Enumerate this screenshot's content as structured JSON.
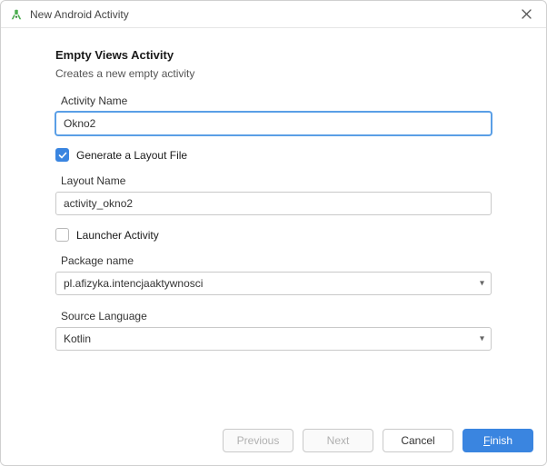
{
  "window": {
    "title": "New Android Activity"
  },
  "header": {
    "title": "Empty Views Activity",
    "subtitle": "Creates a new empty activity"
  },
  "fields": {
    "activityName": {
      "label": "Activity Name",
      "value": "Okno2"
    },
    "generateLayout": {
      "label": "Generate a Layout File",
      "checked": true
    },
    "layoutName": {
      "label": "Layout Name",
      "value": "activity_okno2"
    },
    "launcherActivity": {
      "label": "Launcher Activity",
      "checked": false
    },
    "packageName": {
      "label": "Package name",
      "value": "pl.afizyka.intencjaaktywnosci"
    },
    "sourceLanguage": {
      "label": "Source Language",
      "value": "Kotlin"
    }
  },
  "buttons": {
    "previous": "Previous",
    "next": "Next",
    "cancel": "Cancel",
    "finish": "Finish"
  }
}
